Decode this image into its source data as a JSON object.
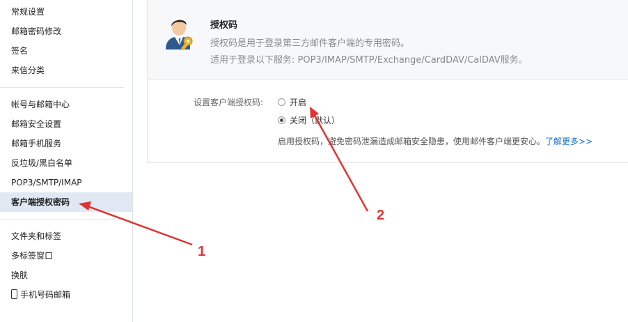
{
  "sidebar": {
    "group1": [
      "常规设置",
      "邮箱密码修改",
      "签名",
      "来信分类"
    ],
    "group2": [
      "帐号与邮箱中心",
      "邮箱安全设置",
      "邮箱手机服务",
      "反垃圾/黑白名单",
      "POP3/SMTP/IMAP",
      "客户端授权密码"
    ],
    "group3": [
      "文件夹和标签",
      "多标签窗口",
      "换肤",
      "手机号码邮箱"
    ],
    "active_item": "客户端授权密码"
  },
  "panel": {
    "icon": "user-key-icon",
    "title": "授权码",
    "desc1": "授权码是用于登录第三方邮件客户端的专用密码。",
    "desc2": "适用于登录以下服务: POP3/IMAP/SMTP/Exchange/CardDAV/CalDAV服务。",
    "setting_label": "设置客户端授权码:",
    "option_on": "开启",
    "option_off": "关闭（默认）",
    "selected": "关闭",
    "hint": "启用授权码，避免密码泄漏造成邮箱安全隐患，使用邮件客户端更安心。",
    "learn_more": "了解更多>>"
  },
  "annotations": {
    "label1": "1",
    "label2": "2",
    "color": "#e03434"
  }
}
